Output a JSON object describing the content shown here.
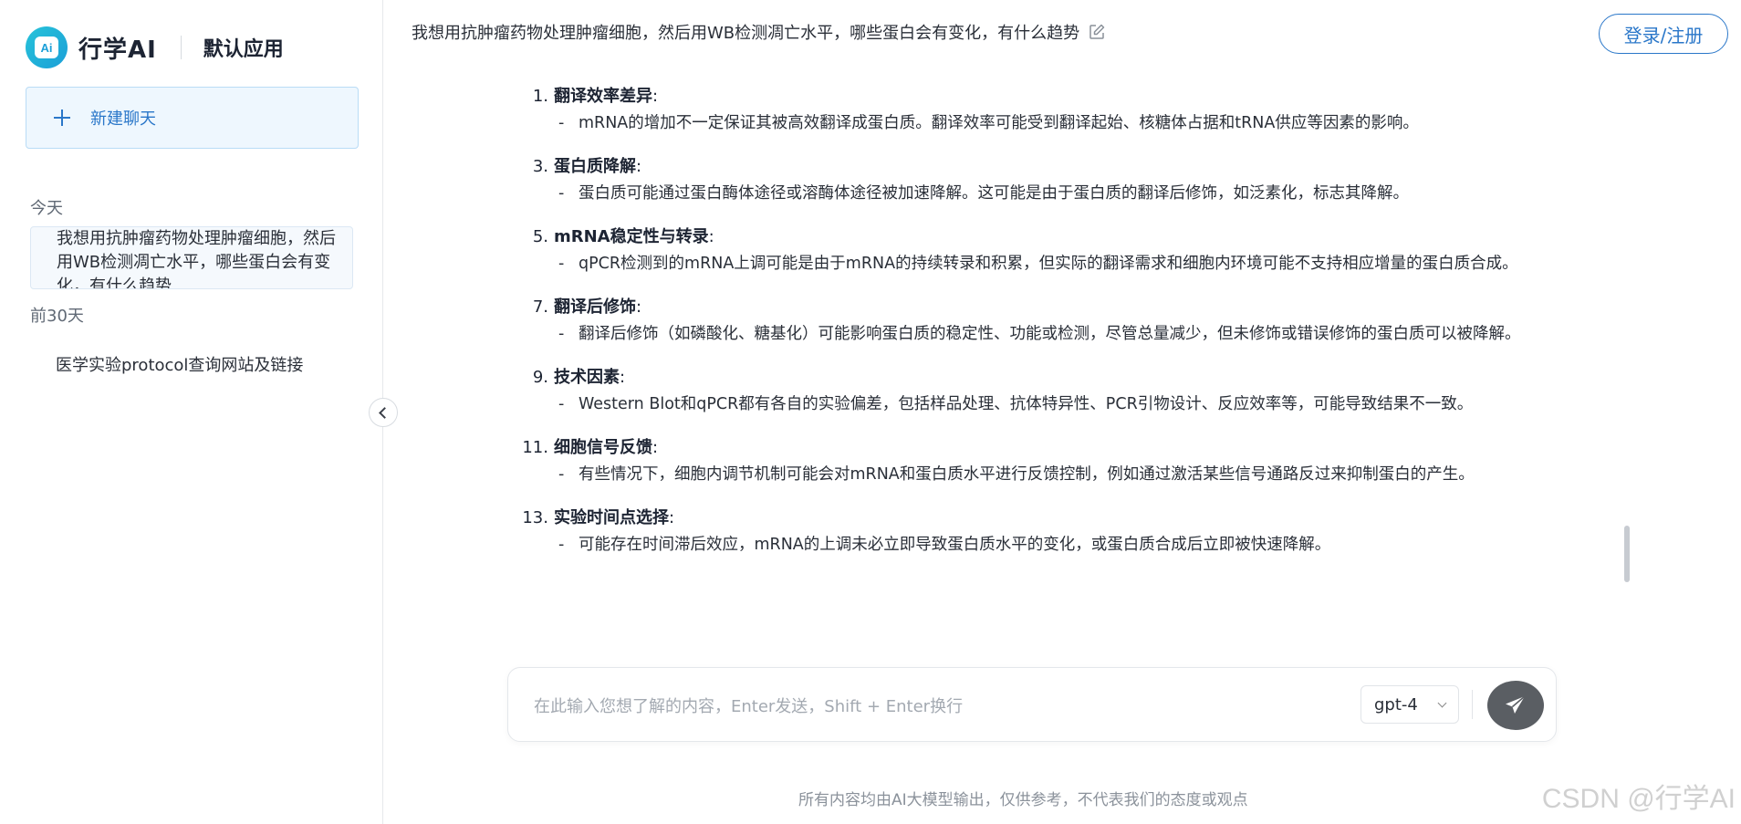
{
  "sidebar": {
    "brand_name": "行学AI",
    "logo_text": "Ai",
    "app_name": "默认应用",
    "new_chat_label": "新建聊天",
    "today_label": "今天",
    "today_item": "我想用抗肿瘤药物处理肿瘤细胞，然后用WB检测凋亡水平，哪些蛋白会有变化，有什么趋势",
    "last30_label": "前30天",
    "last30_item": "医学实验protocol查询网站及链接"
  },
  "header": {
    "question": "我想用抗肿瘤药物处理肿瘤细胞，然后用WB检测凋亡水平，哪些蛋白会有变化，有什么趋势",
    "login_label": "登录/注册"
  },
  "answer": {
    "items": [
      {
        "num": "1.",
        "title": "翻译效率差异",
        "colon": ":",
        "text": "mRNA的增加不一定保证其被高效翻译成蛋白质。翻译效率可能受到翻译起始、核糖体占据和tRNA供应等因素的影响。"
      },
      {
        "num": "3.",
        "title": "蛋白质降解",
        "colon": ":",
        "text": "蛋白质可能通过蛋白酶体途径或溶酶体途径被加速降解。这可能是由于蛋白质的翻译后修饰，如泛素化，标志其降解。"
      },
      {
        "num": "5.",
        "title": "mRNA稳定性与转录",
        "colon": ":",
        "text": "qPCR检测到的mRNA上调可能是由于mRNA的持续转录和积累，但实际的翻译需求和细胞内环境可能不支持相应增量的蛋白质合成。"
      },
      {
        "num": "7.",
        "title": "翻译后修饰",
        "colon": ":",
        "text": "翻译后修饰（如磷酸化、糖基化）可能影响蛋白质的稳定性、功能或检测，尽管总量减少，但未修饰或错误修饰的蛋白质可以被降解。"
      },
      {
        "num": "9.",
        "title": "技术因素",
        "colon": ":",
        "text": "Western Blot和qPCR都有各自的实验偏差，包括样品处理、抗体特异性、PCR引物设计、反应效率等，可能导致结果不一致。"
      },
      {
        "num": "11.",
        "title": "细胞信号反馈",
        "colon": ":",
        "text": "有些情况下，细胞内调节机制可能会对mRNA和蛋白质水平进行反馈控制，例如通过激活某些信号通路反过来抑制蛋白的产生。"
      },
      {
        "num": "13.",
        "title": "实验时间点选择",
        "colon": ":",
        "text": "可能存在时间滞后效应，mRNA的上调未必立即导致蛋白质水平的变化，或蛋白质合成后立即被快速降解。"
      }
    ],
    "dash": "-"
  },
  "input": {
    "placeholder": "在此输入您想了解的内容，Enter发送，Shift + Enter换行",
    "model": "gpt-4"
  },
  "footer_note": "所有内容均由AI大模型输出，仅供参考，不代表我们的态度或观点",
  "watermark": "CSDN @行学AI",
  "colors": {
    "accent": "#2a77c9",
    "send_button": "#5a5e63"
  }
}
